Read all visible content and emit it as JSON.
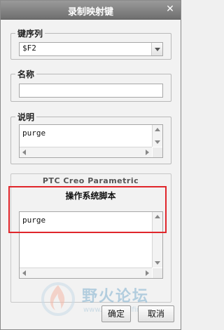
{
  "dialog": {
    "title": "录制映射键",
    "close_glyph": "✕"
  },
  "key_sequence": {
    "legend": "键序列",
    "value": "$F2"
  },
  "name": {
    "legend": "名称",
    "value": ""
  },
  "description": {
    "legend": "说明",
    "value": "purge"
  },
  "ptc_section": {
    "label": "PTC Creo Parametric"
  },
  "os_script": {
    "heading": "操作系统脚本",
    "value": "purge"
  },
  "buttons": {
    "ok": "确定",
    "cancel": "取消"
  },
  "watermark": {
    "text": "野火论坛",
    "url": "www.proewildfire.cn"
  },
  "colors": {
    "titlebar": "#7f7f7f",
    "highlight_box": "#e0262b"
  }
}
